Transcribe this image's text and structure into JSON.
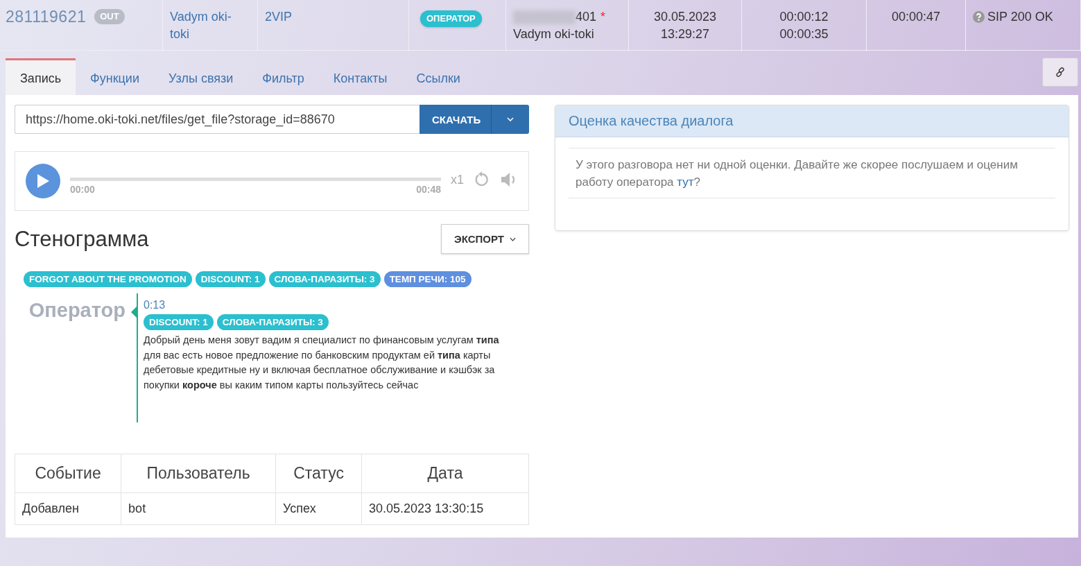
{
  "call_row": {
    "id": "281119621",
    "direction": "OUT",
    "name": "Vadym oki-toki",
    "tariff": "2VIP",
    "role": "ОПЕРАТОР",
    "number_suffix": "401",
    "number_required_mark": "*",
    "operator": "Vadym oki-toki",
    "date": "30.05.2023",
    "time": "13:29:27",
    "wait": "00:00:12",
    "talk": "00:00:35",
    "total": "00:00:47",
    "status": "SIP 200 OK"
  },
  "tabs": [
    {
      "label": "Запись",
      "selected": true
    },
    {
      "label": "Функции",
      "selected": false
    },
    {
      "label": "Узлы связи",
      "selected": false
    },
    {
      "label": "Фильтр",
      "selected": false
    },
    {
      "label": "Контакты",
      "selected": false
    },
    {
      "label": "Ссылки",
      "selected": false
    }
  ],
  "download": {
    "url": "https://home.oki-toki.net/files/get_file?storage_id=88670",
    "button": "СКАЧАТЬ"
  },
  "player": {
    "current": "00:00",
    "duration": "00:48",
    "speed": "x1"
  },
  "transcript": {
    "title": "Стенограмма",
    "export_button": "ЭКСПОРТ",
    "tags": [
      {
        "label": "FORGOT ABOUT THE PROMOTION",
        "color": "#2bbfcf"
      },
      {
        "label": "DISCOUNT: 1",
        "color": "#2bbfcf"
      },
      {
        "label": "СЛОВА-ПАРАЗИТЫ: 3",
        "color": "#2bbfcf"
      },
      {
        "label": "ТЕМП РЕЧИ: 105",
        "color": "#5f8fdf"
      }
    ],
    "entries": [
      {
        "speaker": "Оператор",
        "time": "0:13",
        "tags": [
          {
            "label": "DISCOUNT: 1",
            "color": "#2bbfcf"
          },
          {
            "label": "СЛОВА-ПАРАЗИТЫ: 3",
            "color": "#2bbfcf"
          }
        ],
        "text": "Добрый день меня зовут вадим я специалист по финансовым услугам **типа** для вас есть новое предложение по банковским продуктам ей **типа** карты дебетовые кредитные ну и включая бесплатное обслуживание и кэшбэк за покупки **короче** вы каким типом карты пользуйтесь сейчас"
      }
    ]
  },
  "events_table": {
    "columns": [
      "Событие",
      "Пользователь",
      "Статус",
      "Дата"
    ],
    "rows": [
      [
        "Добавлен",
        "bot",
        "Успех",
        "30.05.2023 13:30:15"
      ]
    ]
  },
  "rating": {
    "title": "Оценка качества диалога",
    "message": "У этого разговора нет ни одной оценки. Давайте же скорее послушаем и оценим работу оператора",
    "link": "тут",
    "message_end": "?"
  }
}
